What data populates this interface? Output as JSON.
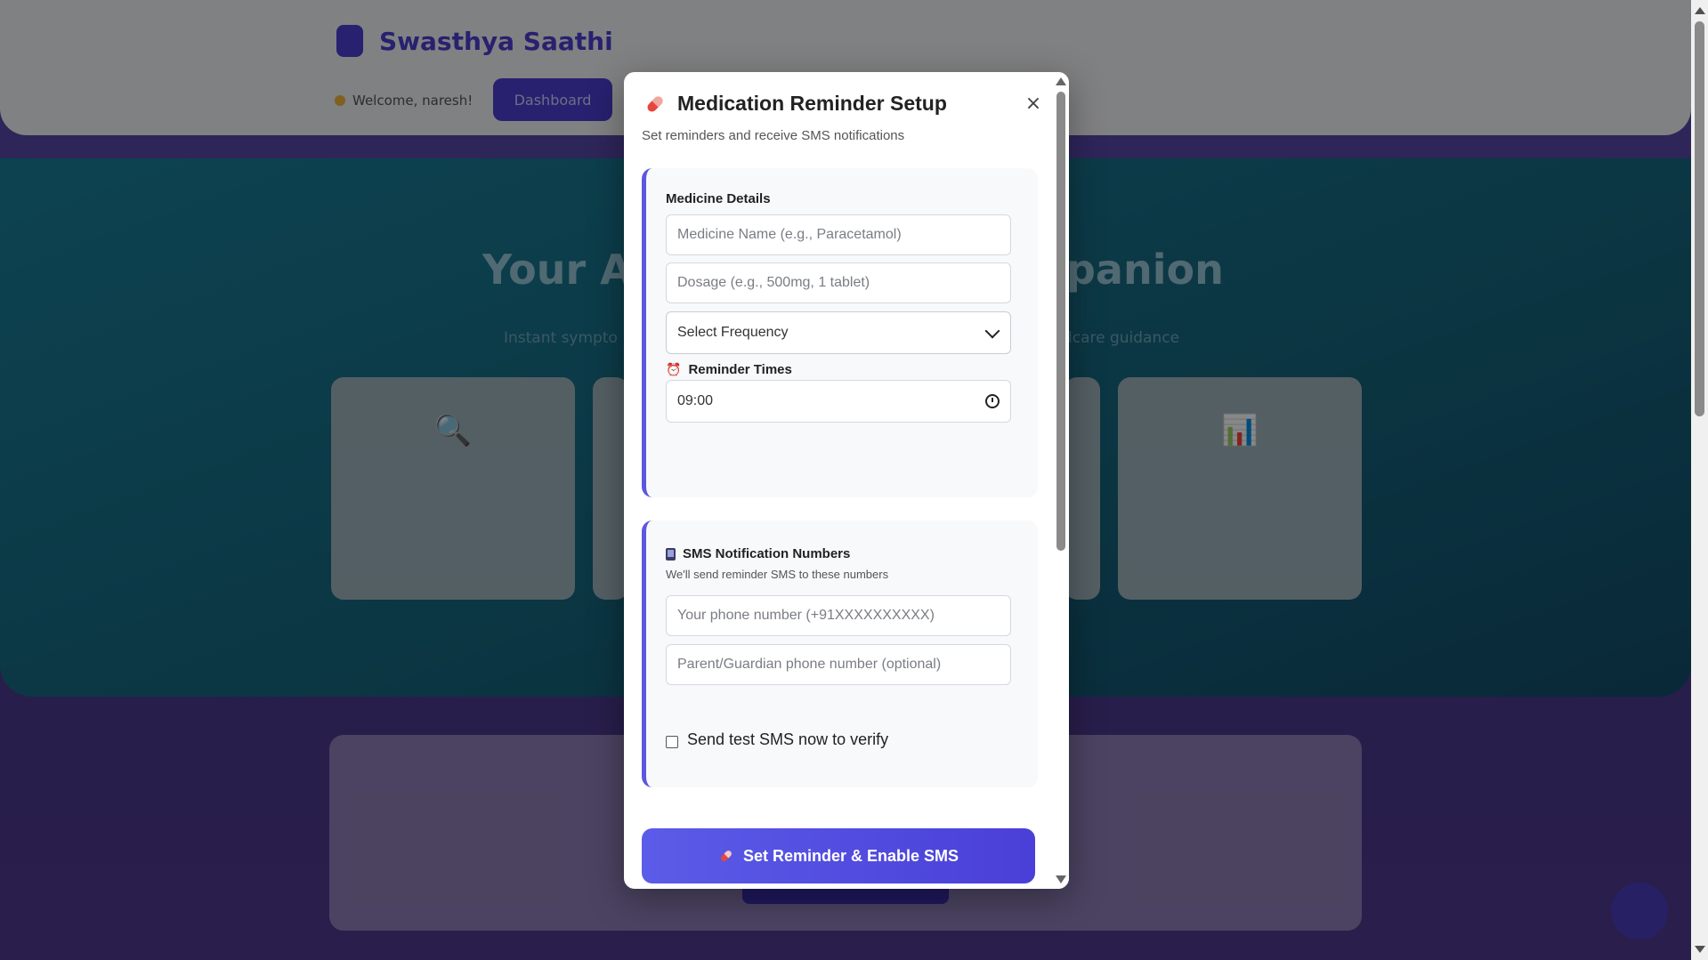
{
  "background": {
    "brand_name": "Swasthya Saathi",
    "welcome_text": "Welcome, naresh!",
    "dashboard_label": "Dashboard",
    "hero_title_left": "Your AI",
    "hero_title_right": "panion",
    "hero_sub_left": "Instant sympto",
    "hero_sub_right": "lcare guidance",
    "card_icons": [
      "magnifier-icon",
      "chart-icon"
    ]
  },
  "modal": {
    "title": "Medication Reminder Setup",
    "subtitle": "Set reminders and receive SMS notifications",
    "close_label": "×",
    "medicine_section": {
      "title": "Medicine Details",
      "name_placeholder": "Medicine Name (e.g., Paracetamol)",
      "dosage_placeholder": "Dosage (e.g., 500mg, 1 tablet)",
      "frequency_selected": "Select Frequency",
      "reminder_times_label": "Reminder Times",
      "time_value": "09:00"
    },
    "sms_section": {
      "title": "SMS Notification Numbers",
      "hint": "We'll send reminder SMS to these numbers",
      "phone_placeholder": "Your phone number (+91XXXXXXXXXX)",
      "guardian_placeholder": "Parent/Guardian phone number (optional)",
      "test_sms_label": "Send test SMS now to verify"
    },
    "submit_label": "Set Reminder & Enable SMS"
  },
  "colors": {
    "accent": "#5b57e0",
    "button": "#4a3fd8"
  }
}
